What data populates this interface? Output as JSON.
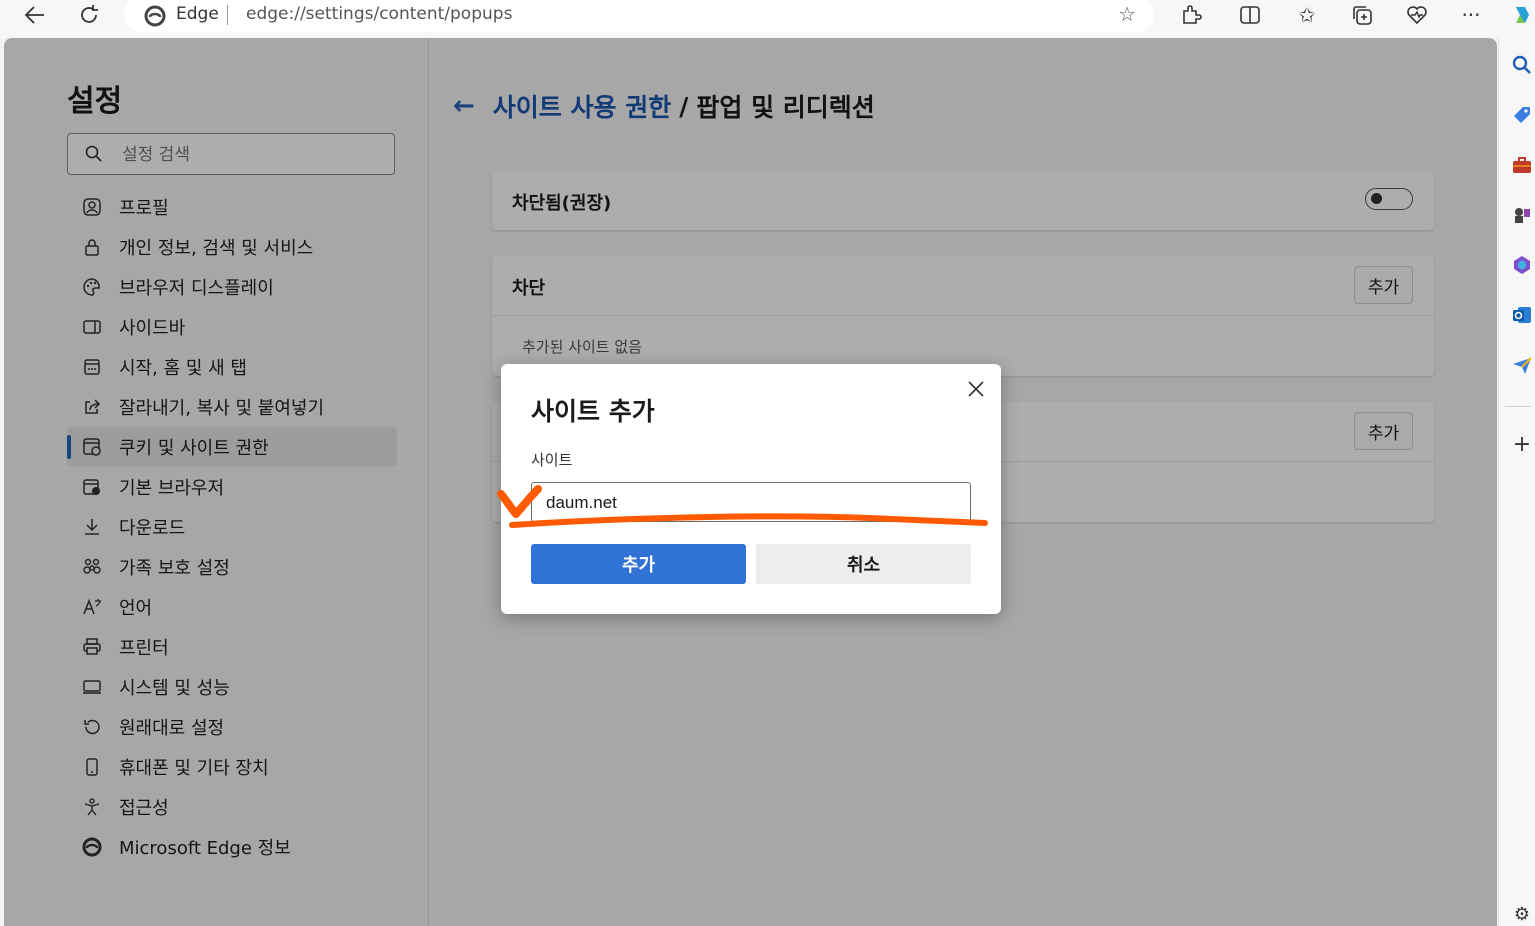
{
  "browser": {
    "brand": "Edge",
    "url": "edge://settings/content/popups",
    "icons": [
      "back-icon",
      "refresh-icon",
      "favorite-star-icon",
      "extensions-icon",
      "split-screen-icon",
      "favorites-icon",
      "collections-icon",
      "browser-essentials-icon",
      "more-icon",
      "copilot-icon"
    ]
  },
  "rail": {
    "icons": [
      "search-icon",
      "shopping-icon",
      "tools-icon",
      "games-icon",
      "microsoft365-icon",
      "outlook-icon",
      "drop-icon",
      "add-icon",
      "settings-icon"
    ]
  },
  "sidebar": {
    "title": "설정",
    "search_placeholder": "설정 검색",
    "items": [
      {
        "label": "프로필",
        "icon": "profile-icon"
      },
      {
        "label": "개인 정보, 검색 및 서비스",
        "icon": "lock-icon"
      },
      {
        "label": "브라우저 디스플레이",
        "icon": "palette-icon"
      },
      {
        "label": "사이드바",
        "icon": "sidebar-icon"
      },
      {
        "label": "시작, 홈 및 새 탭",
        "icon": "home-tab-icon"
      },
      {
        "label": "잘라내기, 복사 및 붙여넣기",
        "icon": "share-icon"
      },
      {
        "label": "쿠키 및 사이트 권한",
        "icon": "cookie-permissions-icon",
        "active": true
      },
      {
        "label": "기본 브라우저",
        "icon": "default-browser-icon"
      },
      {
        "label": "다운로드",
        "icon": "download-icon"
      },
      {
        "label": "가족 보호 설정",
        "icon": "family-icon"
      },
      {
        "label": "언어",
        "icon": "language-icon"
      },
      {
        "label": "프린터",
        "icon": "printer-icon"
      },
      {
        "label": "시스템 및 성능",
        "icon": "system-icon"
      },
      {
        "label": "원래대로 설정",
        "icon": "reset-icon"
      },
      {
        "label": "휴대폰 및 기타 장치",
        "icon": "phone-icon"
      },
      {
        "label": "접근성",
        "icon": "accessibility-icon"
      },
      {
        "label": "Microsoft Edge 정보",
        "icon": "edge-logo-icon"
      }
    ]
  },
  "main": {
    "breadcrumb_link": "사이트 사용 권한",
    "breadcrumb_sep": "/",
    "page_title": "팝업 및 리디렉션",
    "blocked_toggle_label": "차단됨(권장)",
    "blocked_toggle_on": false,
    "block_section": {
      "title": "차단",
      "add_label": "추가",
      "empty_text": "추가된 사이트 없음"
    },
    "allow_section": {
      "add_label": "추가"
    }
  },
  "dialog": {
    "title": "사이트 추가",
    "field_label": "사이트",
    "field_value": "daum.net",
    "confirm_label": "추가",
    "cancel_label": "취소"
  },
  "colors": {
    "accent": "#3172d6",
    "link": "#1a56b0",
    "annotation": "#ff5a00"
  }
}
